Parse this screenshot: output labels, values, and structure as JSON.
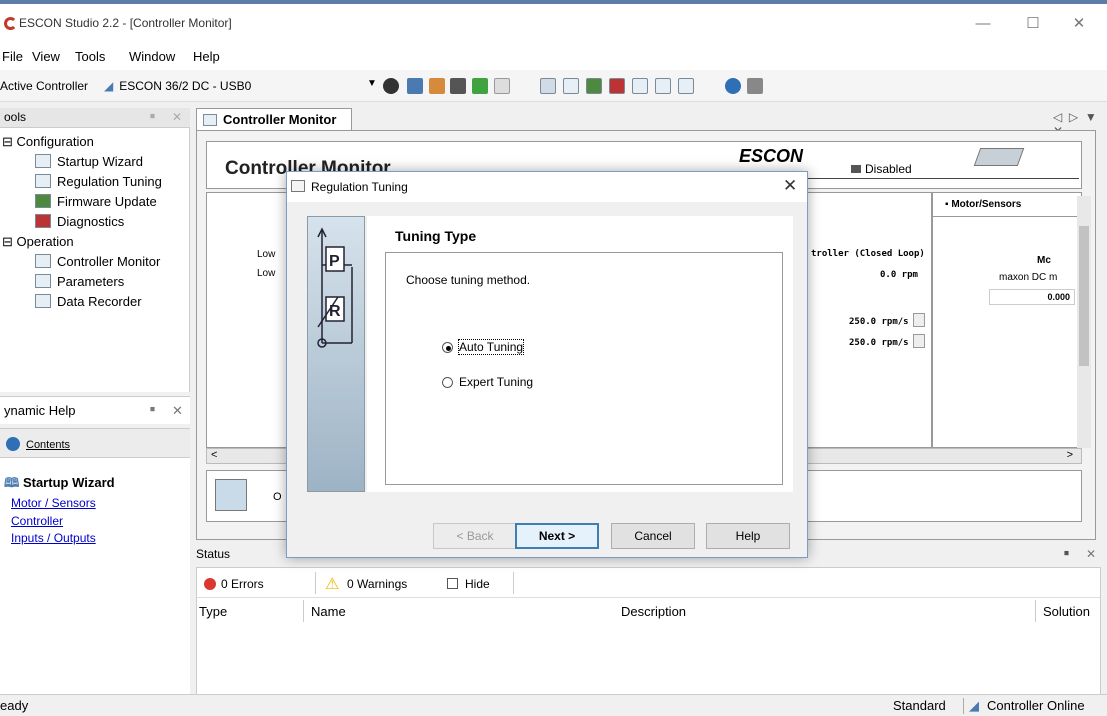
{
  "window": {
    "title": "ESCON Studio 2.2 - [Controller Monitor]"
  },
  "menu": [
    "File",
    "View",
    "Tools",
    "Window",
    "Help"
  ],
  "toolbar": {
    "active_controller_label": "Active Controller",
    "controller_value": "ESCON 36/2 DC - USB0"
  },
  "tools_panel": {
    "title": "ools",
    "configuration": "Configuration",
    "config_items": [
      "Startup Wizard",
      "Regulation Tuning",
      "Firmware Update",
      "Diagnostics"
    ],
    "operation": "Operation",
    "operation_items": [
      "Controller Monitor",
      "Parameters",
      "Data Recorder"
    ]
  },
  "dynamic_help": {
    "title": "ynamic Help",
    "contents": "Contents",
    "heading": "Startup Wizard",
    "links": [
      "Motor / Sensors",
      "Controller",
      "Inputs / Outputs"
    ]
  },
  "doc_tab": "Controller Monitor",
  "monitor": {
    "title": "Controller Monitor",
    "brand": "ESCON",
    "state": "Disabled",
    "low1": "Low",
    "low2": "Low",
    "mode": "troller (Closed Loop)",
    "rpm": "0.0 rpm",
    "accel1": "250.0 rpm/s",
    "accel2": "250.0 rpm/s",
    "right_head": "Motor/Sensors",
    "right_title": "Mc",
    "right_motor": "maxon DC m",
    "right_value": "0.000",
    "action_text": "O"
  },
  "dialog": {
    "title": "Regulation Tuning",
    "heading": "Tuning Type",
    "prompt": "Choose tuning method.",
    "options": [
      {
        "label": "Auto Tuning",
        "selected": true
      },
      {
        "label": "Expert Tuning",
        "selected": false
      }
    ],
    "banner_letters": [
      "P",
      "R"
    ],
    "buttons": {
      "back": "< Back",
      "next": "Next >",
      "cancel": "Cancel",
      "help": "Help"
    }
  },
  "status": {
    "title": "Status",
    "errors": "0 Errors",
    "warnings": "0 Warnings",
    "hide": "Hide",
    "columns": [
      "Type",
      "Name",
      "Description",
      "Solution"
    ]
  },
  "statusbar": {
    "left": "eady",
    "mode": "Standard",
    "online": "Controller Online"
  },
  "colors": {
    "accent": "#3c7fb1",
    "error": "#d9382f",
    "warning": "#f2b600",
    "link": "#0000cc"
  }
}
